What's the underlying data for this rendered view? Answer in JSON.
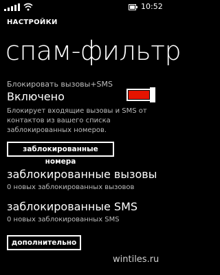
{
  "status_bar": {
    "time": "10:52",
    "icons": [
      "signal-icon",
      "wifi-icon",
      "battery-icon"
    ]
  },
  "app_title": "НАСТРОЙКИ",
  "page_title": "спам-фильтр",
  "block_toggle": {
    "caption": "Блокировать вызовы+SMS",
    "state": "Включено",
    "on": true
  },
  "description": "Блокирует входящие вызовы и SMS от контактов из вашего списка заблокированных номеров.",
  "blocked_numbers_button": "заблокированные номера",
  "blocked_calls": {
    "title": "заблокированные вызовы",
    "subtitle": "0 новых заблокированных вызовов"
  },
  "blocked_sms": {
    "title": "заблокированные SMS",
    "subtitle": "0 новых заблокированных SMS"
  },
  "more_button": "дополнительно",
  "watermark": "wintiles.ru",
  "colors": {
    "background": "#000000",
    "foreground": "#ffffff",
    "accent": "#e51400",
    "secondary_text": "#bdbdbd"
  }
}
